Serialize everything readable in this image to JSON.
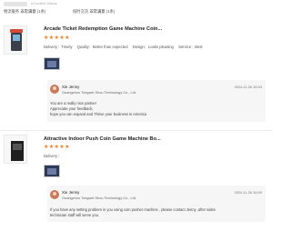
{
  "header": {
    "subtitle": "eContent Status",
    "filters": [
      {
        "prefix": "物流服务",
        "highlight": "非常满意",
        "suffix": "(1条)"
      },
      {
        "prefix": "按时交货",
        "highlight": "非常满意",
        "suffix": "(1条)"
      }
    ]
  },
  "reviews": [
    {
      "title": "Arcade Ticket Redemption Game Machine Coin...",
      "stars": "★★★★★",
      "meta": [
        "Delivery：Timely",
        "Quality：Better than expected",
        "Design：Looks pleasing",
        "Service：Best"
      ],
      "reply": {
        "name": "Xie Jenny",
        "company": "Guangzhou Tongwei Shou Technology Co., Ltd.",
        "date": "2024-11-26 16:03",
        "lines": [
          "You are a really nice partner",
          "Appreciate your feedback,",
          "hope you can expand and Thrive your business in America"
        ]
      }
    },
    {
      "title": "Attractive Indoor Push Coin Game Machine Bo...",
      "stars": "★★★★★",
      "meta": [
        "Delivery："
      ],
      "reply": {
        "name": "Xie Jenny",
        "company": "Guangzhou Tongwei Shou Technology Co., Ltd.",
        "date": "2024-11-26 16:09",
        "lines": [
          "If you have any setting problem in you using coin pusher  machine  , please contact Jenny ,after sales",
          "technician staff will serve you."
        ]
      }
    }
  ]
}
